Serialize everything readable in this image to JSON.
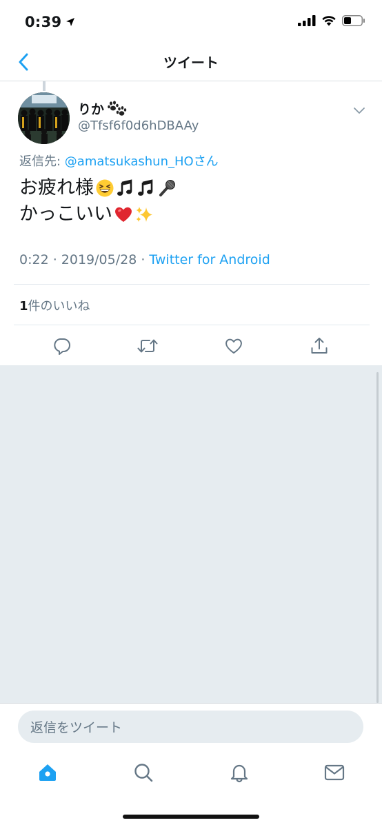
{
  "status": {
    "time": "0:39"
  },
  "nav": {
    "title": "ツイート"
  },
  "tweet": {
    "display_name": "りか",
    "display_name_emoji": "paw-prints-icon",
    "handle": "@Tfsf6f0d6hDBAAy",
    "reply_prefix": "返信先: ",
    "reply_mention": "@amatsukashun_HO",
    "reply_suffix": "さん",
    "text_line1": "お疲れ様",
    "text_line2": "かっこいい",
    "time": "0:22 · 2019/05/28 · ",
    "source": "Twitter for Android",
    "likes_count": "1",
    "likes_label": "件のいいね"
  },
  "reply_bar": {
    "placeholder": "返信をツイート"
  },
  "colors": {
    "accent": "#1da1f2",
    "muted": "#657786",
    "background_grey": "#e6ecf0"
  },
  "icons": [
    "back-chevron-icon",
    "chevron-down-icon",
    "reply-icon",
    "retweet-icon",
    "like-icon",
    "share-icon",
    "home-icon",
    "search-icon",
    "notifications-icon",
    "messages-icon"
  ]
}
